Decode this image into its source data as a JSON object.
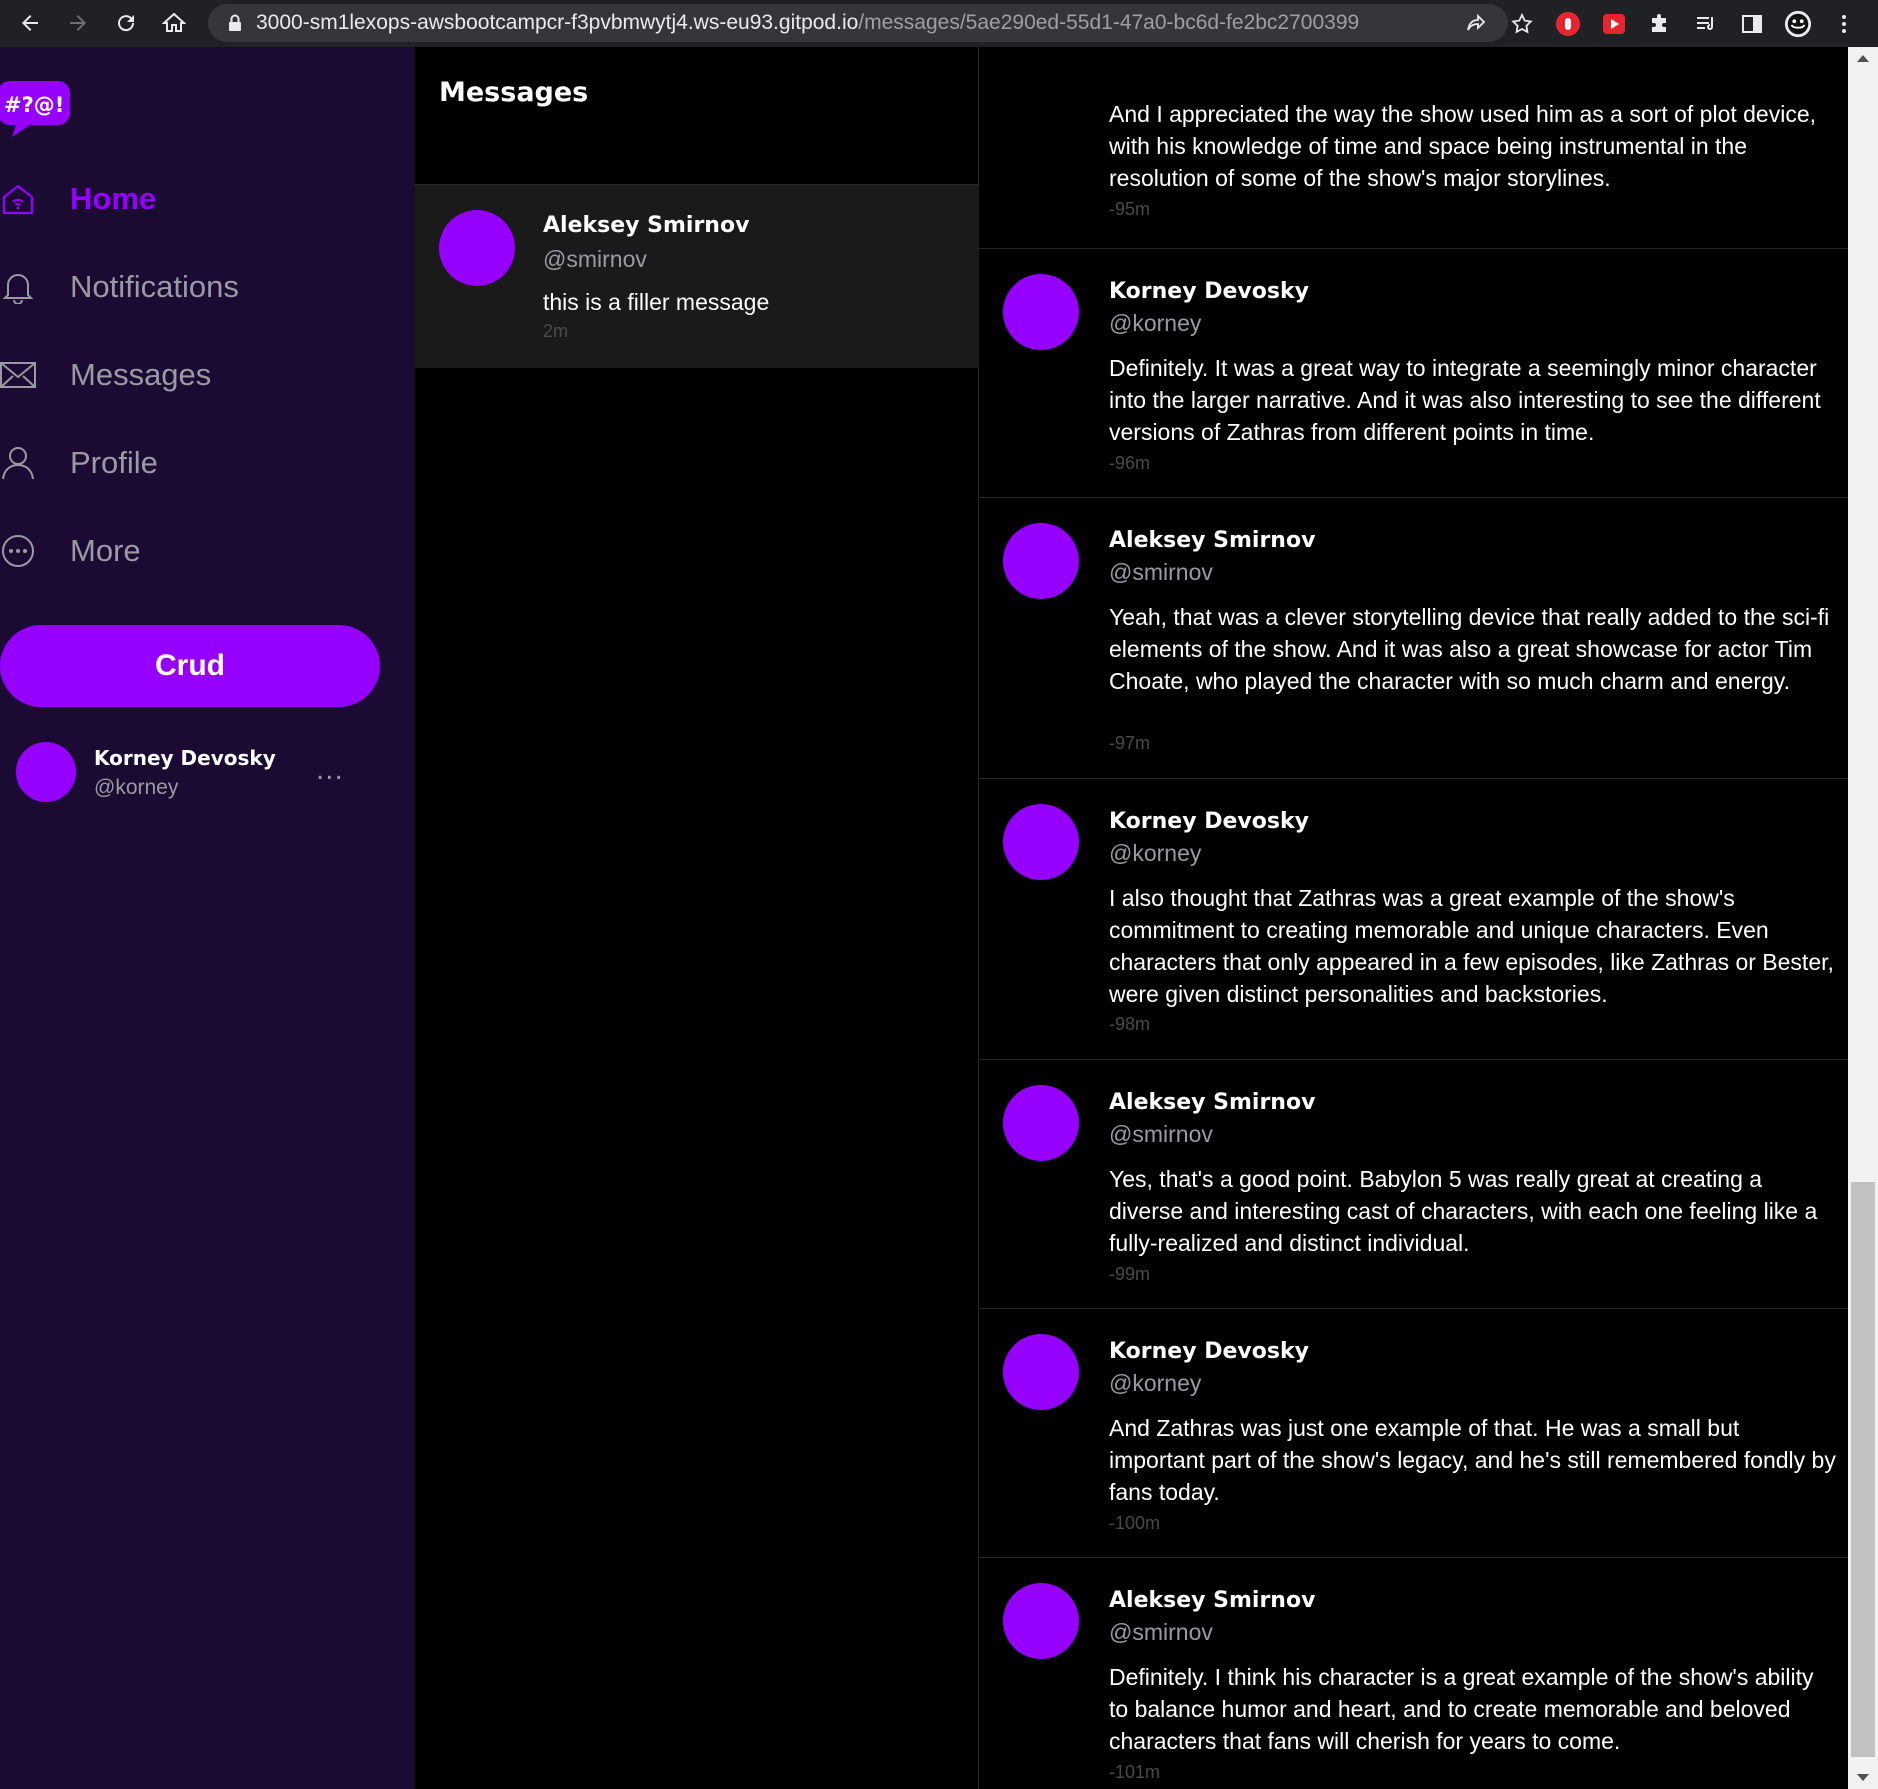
{
  "browser": {
    "url_host": "3000-sm1lexops-awsbootcampcr-f3pvbmwytj4.ws-eu93.gitpod.io",
    "url_path": "/messages/5ae290ed-55d1-47a0-bc6d-fe2bc2700399"
  },
  "sidebar": {
    "logo_text": "#?@!",
    "items": [
      {
        "label": "Home",
        "icon": "home-icon",
        "active": true
      },
      {
        "label": "Notifications",
        "icon": "bell-icon",
        "active": false
      },
      {
        "label": "Messages",
        "icon": "envelope-icon",
        "active": false
      },
      {
        "label": "Profile",
        "icon": "person-icon",
        "active": false
      },
      {
        "label": "More",
        "icon": "more-circle-icon",
        "active": false
      }
    ],
    "crud_label": "Crud",
    "profile": {
      "name": "Korney Devosky",
      "handle": "@korney",
      "more_label": "..."
    }
  },
  "message_list": {
    "title": "Messages",
    "groups": [
      {
        "name": "Aleksey Smirnov",
        "handle": "@smirnov",
        "message": "this is a filler message",
        "time": "2m"
      }
    ]
  },
  "conversation": {
    "messages": [
      {
        "name": "",
        "handle": "",
        "text": "And I appreciated the way the show used him as a sort of plot device, with his knowledge of time and space being instrumental in the resolution of some of the show's major storylines.",
        "time": "-95m"
      },
      {
        "name": "Korney Devosky",
        "handle": "@korney",
        "text": "Definitely. It was a great way to integrate a seemingly minor character into the larger narrative. And it was also interesting to see the different versions of Zathras from different points in time.",
        "time": "-96m"
      },
      {
        "name": "Aleksey Smirnov",
        "handle": "@smirnov",
        "text": "Yeah, that was a clever storytelling device that really added to the sci-fi elements of the show. And it was also a great showcase for actor Tim Choate, who played the character with so much charm and energy.",
        "time": "-97m"
      },
      {
        "name": "Korney Devosky",
        "handle": "@korney",
        "text": "I also thought that Zathras was a great example of the show's commitment to creating memorable and unique characters. Even characters that only appeared in a few episodes, like Zathras or Bester, were given distinct personalities and backstories.",
        "time": "-98m"
      },
      {
        "name": "Aleksey Smirnov",
        "handle": "@smirnov",
        "text": "Yes, that's a good point. Babylon 5 was really great at creating a diverse and interesting cast of characters, with each one feeling like a fully-realized and distinct individual.",
        "time": "-99m"
      },
      {
        "name": "Korney Devosky",
        "handle": "@korney",
        "text": "And Zathras was just one example of that. He was a small but important part of the show's legacy, and he's still remembered fondly by fans today.",
        "time": "-100m"
      },
      {
        "name": "Aleksey Smirnov",
        "handle": "@smirnov",
        "text": "Definitely. I think his character is a great example of the show's ability to balance humor and heart, and to create memorable and beloved characters that fans will cherish for years to come.",
        "time": "-101m"
      }
    ]
  },
  "colors": {
    "accent": "#9500ff",
    "sidebar_bg": "#1b0a32",
    "muted_text": "#9b99a3"
  }
}
